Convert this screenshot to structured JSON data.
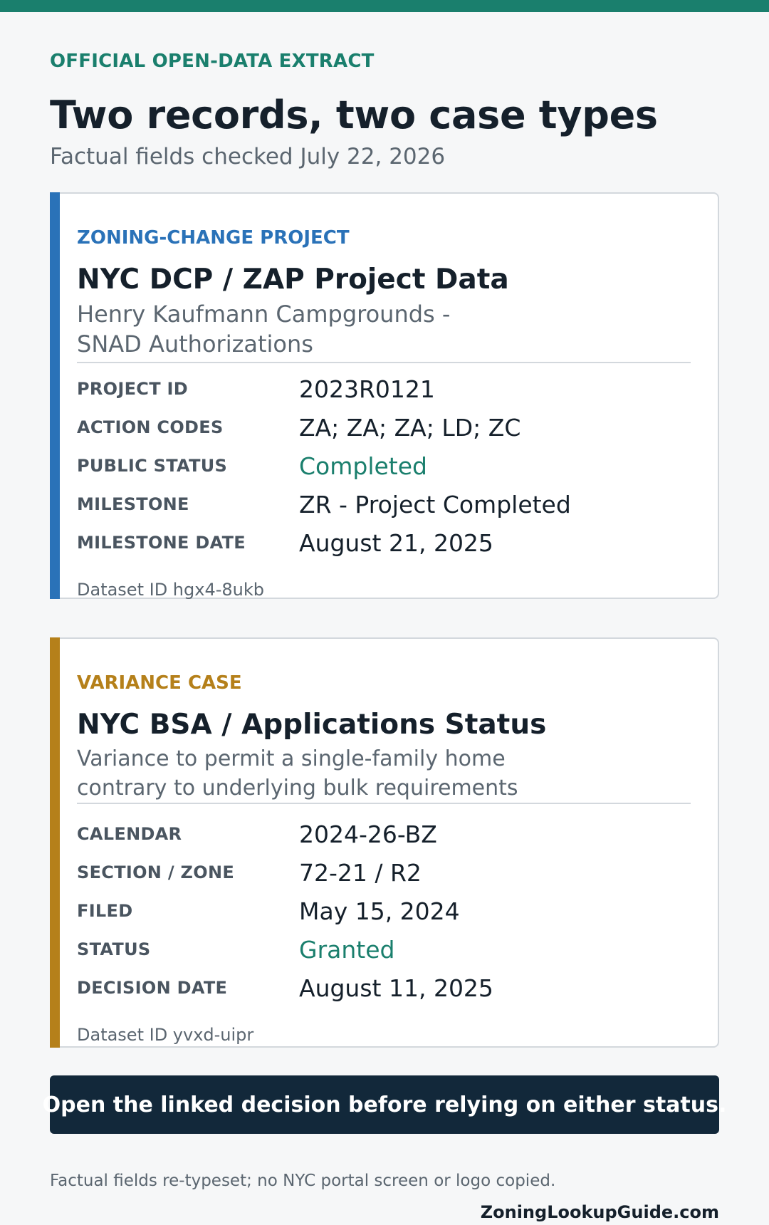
{
  "header": {
    "eyebrow": "OFFICIAL OPEN-DATA EXTRACT",
    "title": "Two records, two case types",
    "subtitle": "Factual fields checked July 22, 2026"
  },
  "colors": {
    "brand_green": "#1a7f6d",
    "zoning_blue": "#2a72b8",
    "variance_gold": "#b5801a",
    "notice_navy": "#12283a"
  },
  "records": [
    {
      "kicker": "ZONING-CHANGE PROJECT",
      "source": "NYC DCP / ZAP Project Data",
      "description_lines": [
        "Henry Kaufmann Campgrounds -",
        "SNAD Authorizations"
      ],
      "fields": [
        {
          "label": "PROJECT ID",
          "value": "2023R0121"
        },
        {
          "label": "ACTION CODES",
          "value": "ZA; ZA; ZA; LD; ZC"
        },
        {
          "label": "PUBLIC STATUS",
          "value": "Completed"
        },
        {
          "label": "MILESTONE",
          "value": "ZR - Project Completed"
        },
        {
          "label": "MILESTONE DATE",
          "value": "August 21, 2025"
        }
      ],
      "dataset": "Dataset ID hgx4-8ukb"
    },
    {
      "kicker": "VARIANCE CASE",
      "source": "NYC BSA / Applications Status",
      "description_lines": [
        "Variance to permit a single-family home",
        "contrary to underlying bulk requirements"
      ],
      "fields": [
        {
          "label": "CALENDAR",
          "value": "2024-26-BZ"
        },
        {
          "label": "SECTION / ZONE",
          "value": "72-21 / R2"
        },
        {
          "label": "FILED",
          "value": "May 15, 2024"
        },
        {
          "label": "STATUS",
          "value": "Granted"
        },
        {
          "label": "DECISION DATE",
          "value": "August 11, 2025"
        }
      ],
      "dataset": "Dataset ID yvxd-uipr"
    }
  ],
  "notice": "Open the linked decision before relying on either status.",
  "footnote": "Factual fields re-typeset; no NYC portal screen or logo copied.",
  "site": "ZoningLookupGuide.com"
}
